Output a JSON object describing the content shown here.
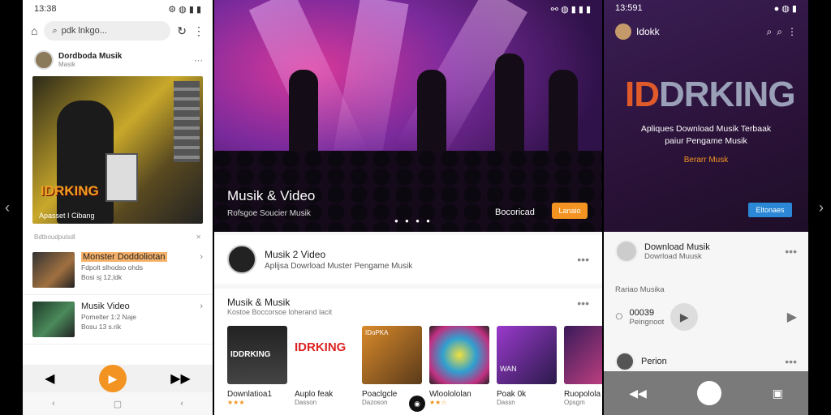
{
  "panel1": {
    "status_time": "13:38",
    "status_icons": "⚙ ◍ ▮ ▮",
    "url": "pdk lnkgo...",
    "channel": {
      "title": "Dordboda Musik",
      "subtitle": "Masik"
    },
    "hero": {
      "logo": "IDRKING",
      "caption": "Apasset I Cibang"
    },
    "section_label": "Bdtboudpulsdl",
    "list": [
      {
        "title": "Monster Doddoliotan",
        "sub1": "Fdpolt slhodso ohds",
        "sub2": "Bosi sj 12,ldk"
      },
      {
        "title": "Musik Video",
        "sub1": "Pomelter 1:2 Naje",
        "sub2": "Bosu 13 s.rik"
      }
    ],
    "player": {
      "prev": "◀",
      "play": "▶",
      "next": "▶▶"
    },
    "nav": {
      "back": "‹",
      "home": "▢",
      "recent": "‹"
    }
  },
  "panel2": {
    "status_icons": "⚯ ◍ ▮ ▮ ▮",
    "hero": {
      "title": "Musik & Video",
      "subtitle": "Rofsgoe Soucier Musik",
      "dots": "● ● ● ●",
      "download": "Bocoricad",
      "button": "Lanaio"
    },
    "card": {
      "title": "Musik 2 Video",
      "sub": "Aplijsa Dowrload Muster Pengame Musik"
    },
    "section": {
      "title": "Musik & Musik",
      "sub": "Kostoe Boccorsoe loherand lacit"
    },
    "tiles": [
      {
        "label": "Downlatioa1",
        "sub": "★★★",
        "art": "IDDRKING"
      },
      {
        "label": "Auplo feak",
        "sub": "Dasson",
        "art": "IDRKING"
      },
      {
        "label": "Poaclgcle",
        "sub": "Dazoson",
        "art": "IDoPKA"
      },
      {
        "label": "Wloolololan",
        "sub": "★★☆",
        "art": ""
      },
      {
        "label": "Poak 0k",
        "sub": "Dassn",
        "art": "WAN"
      },
      {
        "label": "Ruopolola",
        "sub": "Opsgm",
        "art": ""
      }
    ]
  },
  "panel3": {
    "status_time": "13:591",
    "status_icons": "● ◍ ▮",
    "header_title": "Idokk",
    "logo": {
      "prefix": "ID",
      "rest": "DRKING"
    },
    "subtitle": "Apliques Download Musik Terbaak\npaiur Pengame Musik",
    "tagline": "Berarr Musk",
    "button": "Eltonaes",
    "item1": {
      "title": "Download Musik",
      "sub": "Dowrload Muusk"
    },
    "section": "Rariao Musika",
    "item2": {
      "title": "00039",
      "sub": "Peingnoot"
    },
    "item3": {
      "title": "Perion"
    }
  }
}
